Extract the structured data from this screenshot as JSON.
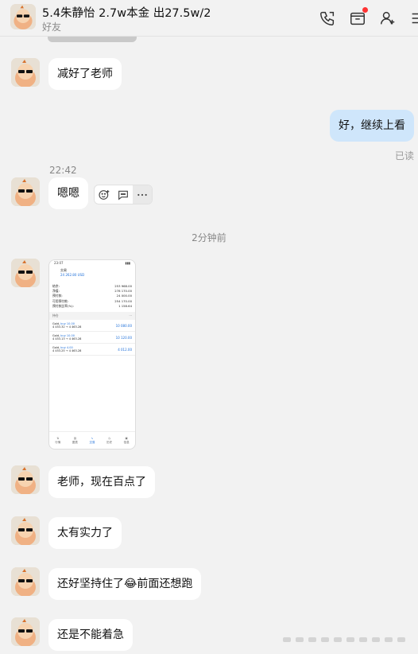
{
  "header": {
    "title": "5.4朱静怡 2.7w本金 出27.5w/2",
    "subtitle": "好友",
    "icons": [
      "phone-icon",
      "folder-icon",
      "add-friend-icon",
      "more-menu-icon"
    ]
  },
  "messages": [
    {
      "id": "m1",
      "text": "减好了老师",
      "sender": "contact"
    },
    {
      "id": "m2",
      "text": "好，继续上看",
      "sender": "me",
      "status": "已读"
    },
    {
      "id": "m3",
      "time": "22:42",
      "text": "嗯嗯",
      "sender": "contact"
    },
    {
      "id": "m4",
      "center_time": "2分钟前"
    },
    {
      "id": "m6",
      "text": "老师，现在百点了",
      "sender": "contact"
    },
    {
      "id": "m7",
      "text": "太有实力了",
      "sender": "contact"
    },
    {
      "id": "m8",
      "text_before": "还好坚持住了",
      "emoji": "😂",
      "text_after": "前面还想跑",
      "sender": "contact"
    },
    {
      "id": "m9",
      "text": "还是不能着急",
      "sender": "contact"
    }
  ],
  "screenshot": {
    "status_time": "23:07",
    "title": "交易",
    "balance_line": "24 262.80 USD",
    "rows": [
      {
        "label": "结余:",
        "value": "253 968.00"
      },
      {
        "label": "净值:",
        "value": "278 170.00"
      },
      {
        "label": "预付款:",
        "value": "24 000.00"
      },
      {
        "label": "可用预付款:",
        "value": "254 170.00"
      },
      {
        "label": "预付款比率(%):",
        "value": "1 158.64"
      }
    ],
    "positions_label": "持仓",
    "positions": [
      {
        "name": "Gold,",
        "side": "buy 10.00",
        "prices": "4 453.32 → 4 463.28",
        "profit": "10 080.00"
      },
      {
        "name": "Gold,",
        "side": "buy 10.00",
        "prices": "4 453.13 → 4 463.28",
        "profit": "10 120.00"
      },
      {
        "name": "Gold,",
        "side": "buy 4.00",
        "prices": "4 453.25 → 4 463.28",
        "profit": "4 012.00"
      }
    ],
    "nav": [
      "行情",
      "图表",
      "交易",
      "历史",
      "信息"
    ]
  },
  "actions": [
    "emoji-react-icon",
    "reply-icon",
    "more-icon"
  ],
  "colors": {
    "bubble_me": "#cfe6fb",
    "bubble_other": "#ffffff",
    "background": "#f2f2f2"
  }
}
